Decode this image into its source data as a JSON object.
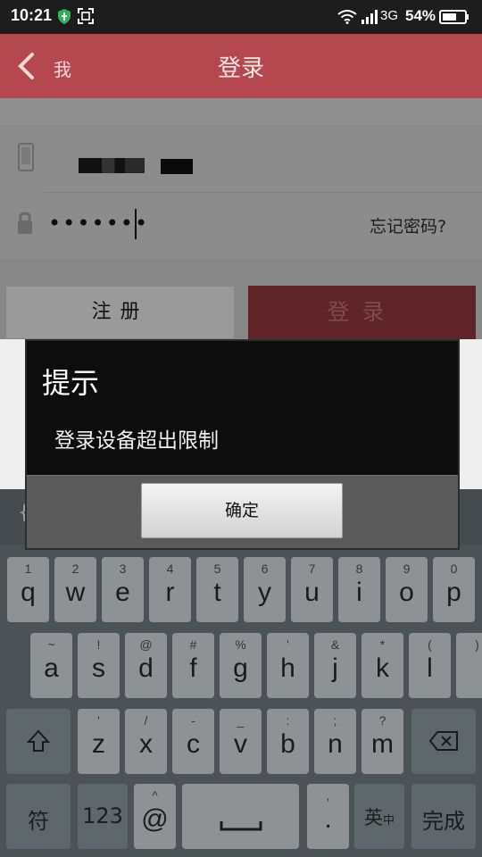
{
  "status_bar": {
    "time": "10:21",
    "network": "3G",
    "battery": "54%"
  },
  "nav": {
    "back_label": "我",
    "title": "登录"
  },
  "form": {
    "password_value": "•••••••",
    "forgot_password": "忘记密码?",
    "register_label": "注册",
    "login_label": "登录"
  },
  "dialog": {
    "title": "提示",
    "message": "登录设备超出限制",
    "ok_label": "确定"
  },
  "keyboard": {
    "row1": [
      {
        "sub": "1",
        "main": "q"
      },
      {
        "sub": "2",
        "main": "w"
      },
      {
        "sub": "3",
        "main": "e"
      },
      {
        "sub": "4",
        "main": "r"
      },
      {
        "sub": "5",
        "main": "t"
      },
      {
        "sub": "6",
        "main": "y"
      },
      {
        "sub": "7",
        "main": "u"
      },
      {
        "sub": "8",
        "main": "i"
      },
      {
        "sub": "9",
        "main": "o"
      },
      {
        "sub": "0",
        "main": "p"
      }
    ],
    "row2": [
      {
        "sub": "~",
        "main": "a"
      },
      {
        "sub": "!",
        "main": "s"
      },
      {
        "sub": "@",
        "main": "d"
      },
      {
        "sub": "#",
        "main": "f"
      },
      {
        "sub": "%",
        "main": "g"
      },
      {
        "sub": "'",
        "main": "h"
      },
      {
        "sub": "&",
        "main": "j"
      },
      {
        "sub": "*",
        "main": "k"
      },
      {
        "sub": "(",
        "main": "l"
      },
      {
        "sub": ")",
        "main": ""
      }
    ],
    "row3": [
      {
        "sub": "'",
        "main": "z"
      },
      {
        "sub": "/",
        "main": "x"
      },
      {
        "sub": "-",
        "main": "c"
      },
      {
        "sub": "_",
        "main": "v"
      },
      {
        "sub": ":",
        "main": "b"
      },
      {
        "sub": ";",
        "main": "n"
      },
      {
        "sub": "?",
        "main": "m"
      }
    ],
    "symbol_label": "符",
    "numeric_label": "123",
    "at_sub": "^",
    "at_label": "@",
    "comma_sub": ",",
    "period_label": ".",
    "lang_label": "英",
    "lang_sub": "中",
    "done_label": "完成",
    "suggest_glyph": "{"
  },
  "colors": {
    "accent": "#b5484e",
    "dialog_bg": "#0d0d0d"
  }
}
